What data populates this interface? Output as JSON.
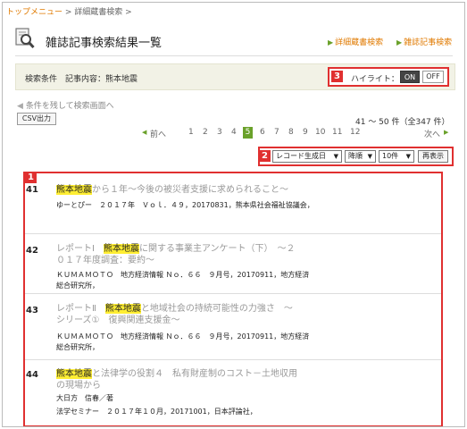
{
  "breadcrumb": {
    "home": "トップメニュー",
    "sep": " > ",
    "current": "詳細蔵書検索",
    "trail": " >"
  },
  "header": {
    "title": "雑誌記事検索結果一覧",
    "link1": "詳細蔵書検索",
    "link2": "雑誌記事検索",
    "icon": "magnifier-document-icon"
  },
  "condition": {
    "text": "検索条件　記事内容：熊本地震"
  },
  "highlight": {
    "label": "ハイライト：",
    "on": "ON",
    "off": "OFF",
    "badge": "3"
  },
  "back_link": "条件を残して検索画面へ",
  "csv_button": "CSV出力",
  "count": "41 ～ 50 件（全347 件）",
  "pager": {
    "prev": "前へ",
    "next": "次へ",
    "pages": [
      "1",
      "2",
      "3",
      "4",
      "5",
      "6",
      "7",
      "8",
      "9",
      "10",
      "11",
      "12"
    ],
    "current": "5"
  },
  "sort": {
    "badge": "2",
    "order_by": "レコード生成日",
    "direction": "降順",
    "per_page": "10件",
    "redisplay": "再表示"
  },
  "results_badge": "1",
  "results": [
    {
      "num": "41",
      "hl": "熊本地震",
      "rest": "から１年～今後の被災者支援に求められること～",
      "meta": [
        "ゆーとぴー　２０１７年　Ｖｏｌ．４９，20170831，熊本県社会福祉協議会，"
      ]
    },
    {
      "num": "42",
      "pre": "レポートⅠ　",
      "hl": "熊本地震",
      "rest": "に関する事業主アンケート（下）　～２０１７年度調査：要約～",
      "meta": [
        "ＫＵＭＡＭＯＴＯ　地方経済情報 Ｎｏ．６６　９月号，20170911，地方経済",
        "総合研究所，"
      ]
    },
    {
      "num": "43",
      "pre": "レポートⅡ　",
      "hl": "熊本地震",
      "rest": "と地域社会の持続可能性の力強さ　～シリーズ①　復興関連支援金～",
      "meta": [
        "ＫＵＭＡＭＯＴＯ　地方経済情報 Ｎｏ．６６　９月号，20170911，地方経済",
        "総合研究所，"
      ]
    },
    {
      "num": "44",
      "hl": "熊本地震",
      "rest": "と法律学の役割４　私有財産制のコスト－土地収用の現場から",
      "meta": [
        "大日方　信春／著",
        "法学セミナー　２０１７年１０月，20171001，日本評論社，"
      ]
    }
  ]
}
